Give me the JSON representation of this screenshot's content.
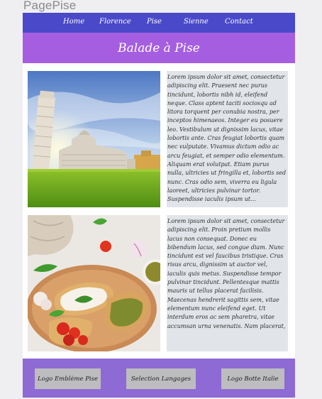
{
  "app": {
    "title": "PagePise"
  },
  "nav": {
    "items": [
      "Home",
      "Florence",
      "Pise",
      "Sienne",
      "Contact"
    ]
  },
  "banner": {
    "title": "Balade à Pise"
  },
  "sections": [
    {
      "image": "leaning-tower-of-pisa-photo",
      "text": "Lorem ipsum dolor sit amet, consectetur adipiscing elit. Praesent nec purus tincidunt, lobortis nibh id, eleifend neque. Class aptent taciti sociosqu ad litora torquent per conubia nostra, per inceptos himenaeos. Integer eu posuere leo. Vestibulum ut dignissim lacus, vitae lobortis ante. Cras feugiat lobortis quam nec vulputate. Vivamus dictum odio ac arcu feugiat, et semper odio elementum. Aliquam erat volutpat. Etiam purus nulla, ultricies ut fringilla et, lobortis sed nunc. Cras odio sem, viverra eu ligula laoreet, ultricies pulvinar tortor. Suspendisse iaculis ipsum ut..."
    },
    {
      "image": "bruschetta-food-photo",
      "text": "Lorem ipsum dolor sit amet, consectetur adipiscing elit. Proin pretium mollis lacus non consequat. Donec eu bibendum lacus, sed congue diam. Nunc tincidunt est vel faucibus tristique. Cras risus arcu, dignissim ut auctor vel, iaculis quis metus. Suspendisse tempor pulvinar tincidunt. Pellentesque mattis mauris ut tellus placerat facilisis. Maecenas hendrerit sagittis sem, vitae elementum nunc eleifend eget. Ut interdum eros ac sem pharetra, vitae accumsan urna venenatis. Nam placerat,"
    }
  ],
  "footer": {
    "buttons": [
      "Logo Emblème Pise",
      "Selection Langages",
      "Logo Botte Italie"
    ]
  },
  "colors": {
    "nav": "#4a49c9",
    "banner": "#a55ee0",
    "footer": "#8e6ad4",
    "textbox": "#e1e5e9",
    "button": "#bdbdbf"
  }
}
